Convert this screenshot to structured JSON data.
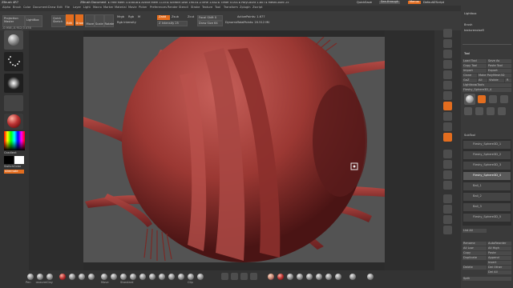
{
  "title_bar": {
    "app": "ZBrush 4R7",
    "document": "ZBrush Document",
    "stats": "▸ Free Mem 3.458GB ▸ Active Mem 1135 ▸ Scratch Disk 1903 ▸ ZTime 1.842 ▸ Timer 0.001 ▸ PolyCount 1.807 ▸ MeshCount 25",
    "quicksave": "QuickSave",
    "seethrough": "See-through",
    "menus_btn": "Menus",
    "script": "DefaultZScript"
  },
  "menu_bar": [
    "Alpha",
    "Brush",
    "Color",
    "Document",
    "Draw",
    "Edit",
    "File",
    "Layer",
    "Light",
    "Macro",
    "Marker",
    "Material",
    "Movie",
    "Picker",
    "Preferences",
    "Render",
    "Stencil",
    "Stroke",
    "Texture",
    "Tool",
    "Transform",
    "Zplugin",
    "Zscript"
  ],
  "top_shelf": {
    "projection_master": "Projection Master",
    "lightbox": "LightBox",
    "quick_sketch": "Quick Sketch",
    "edit": "Edit",
    "draw": "Draw",
    "move": "Move",
    "scale": "Scale",
    "rotate": "Rotate",
    "mrgb": "Mrgb",
    "rgb": "Rgb",
    "m": "M",
    "zadd": "Zadd",
    "zsub": "Zsub",
    "zcut": "Zcut",
    "rgb_intensity": "Rgb Intensity",
    "focal_shift": "Focal Shift 0",
    "z_intensity": "Z Intensity 25",
    "draw_size": "Draw Size 64",
    "dynamic": "Dynamic",
    "active_points": "ActivePoints: 1.677",
    "total_points": "TotalPoints: 20.512 Mil",
    "coords": "-0.958,-0.912,0.478"
  },
  "left_tray": {
    "gradient": "Gradient",
    "switch_color": "SwitchColor",
    "alternate": "Alternate"
  },
  "right_panel": {
    "lightbox_section": "Lightbox",
    "brush_section": "Brush",
    "brush_name": "texturenoisefl",
    "tool_section": "Tool",
    "load_tool": "Load Tool",
    "save_as": "Save As",
    "copy_tool": "Copy Tool",
    "paste_tool": "Paste Tool",
    "import": "Import",
    "export": "Export",
    "clone": "Clone",
    "make_polymesh": "Make PolyMesh3D",
    "goz": "GoZ",
    "all": "All",
    "visible": "Visible",
    "r": "R",
    "lightbox_tools": "Lightbox▸Tools",
    "current_tool": "Fleshy_Sphere3D_4",
    "subtool": "SubTool",
    "subtool_items": [
      "Fleshy_Sphere3D_1",
      "Fleshy_Sphere3D_2",
      "Fleshy_Sphere3D_3",
      "Fleshy_Sphere3D_4",
      "Ball_1",
      "Ball_2",
      "Ball_3",
      "Fleshy_Sphere3D_5"
    ],
    "list_all": "List All",
    "rename": "Rename",
    "autoreorder": "AutoReorder",
    "all_low": "All Low",
    "all_high": "All High",
    "copy": "Copy",
    "paste": "Paste",
    "duplicate": "Duplicate",
    "append": "Append",
    "insert": "Insert",
    "delete": "Delete",
    "del_other": "Del Other",
    "del_all": "Del All",
    "split": "Split"
  },
  "bottom_shelf": {
    "brushes": [
      "Pen",
      "TexturenoiseFl",
      "Clay",
      "ClayBuildup",
      "DamStandard",
      "hPolish",
      "Inflate",
      "Move",
      "Pinch",
      "Standard",
      "ZModeler",
      "Flatten",
      "Snakehook",
      "Slash3",
      "Move Topo",
      "Polish",
      "Clip",
      "Trim"
    ],
    "materials": [
      "SkinShade4",
      "MatCap Red",
      "BasicMaterial",
      "Toy Plastic",
      "BlinnWax",
      "MatCap Gray",
      "ReflectedMap",
      "Dots"
    ],
    "colors": {
      "accent": "#e36d1f",
      "model": "#9b3833",
      "canvas": "#535353"
    }
  }
}
